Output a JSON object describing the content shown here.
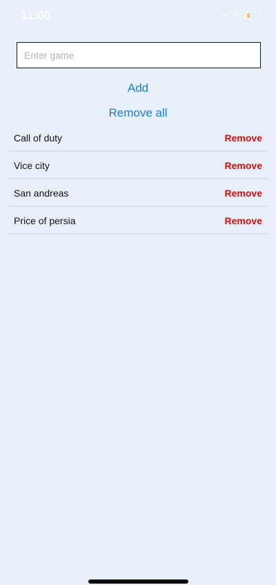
{
  "status_bar": {
    "time": "11:00",
    "icons": [
      "location-arrow-icon",
      "wifi-icon",
      "battery-icon"
    ],
    "battery_color": "#f2c94c"
  },
  "input": {
    "placeholder": "Enter game",
    "value": ""
  },
  "actions": {
    "add_label": "Add",
    "remove_all_label": "Remove all"
  },
  "games": [
    {
      "name": "Call of duty",
      "remove_label": "Remove"
    },
    {
      "name": "Vice city",
      "remove_label": "Remove"
    },
    {
      "name": "San andreas",
      "remove_label": "Remove"
    },
    {
      "name": "Price of persia",
      "remove_label": "Remove"
    }
  ],
  "colors": {
    "background": "#e7eff8",
    "link": "#1a7dd8",
    "remove": "#d40f0f",
    "divider": "#d9e3ee"
  }
}
